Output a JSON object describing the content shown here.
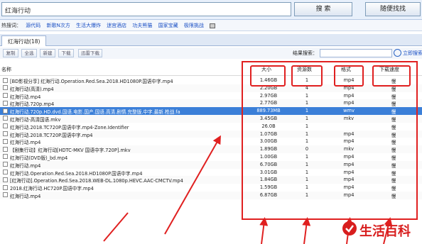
{
  "search": {
    "value": "红海行动",
    "button": "搜 索",
    "random_button": "随便找找"
  },
  "hot": {
    "label": "热搜词：",
    "links": [
      "源代码",
      "新歌N次方",
      "生活大爆炸",
      "迷宫酒店",
      "功夫熊猫",
      "国家宝藏",
      "极限挑战"
    ]
  },
  "tab": {
    "label": "红海行动(18)"
  },
  "toolbar": {
    "buttons": [
      "复制",
      "全选",
      "新建",
      "下载",
      "迅雷下载"
    ],
    "filter_label": "结果搜索：",
    "adv_label": "立即搜索"
  },
  "columns": {
    "name": "名称",
    "size": "大小",
    "sources": "资源数",
    "format": "格式",
    "speed": "下载速度"
  },
  "rows": [
    {
      "name": "[BD影视分享] 红海行动.Operation.Red.Sea.2018.HD1080P.国语中字.mp4",
      "size": "1.46GB",
      "sources": "1",
      "format": "mp4",
      "speed": "慢",
      "selected": false
    },
    {
      "name": "红海行动(高清).mp4",
      "size": "2.20GB",
      "sources": "4",
      "format": "mp4",
      "speed": "慢",
      "selected": false
    },
    {
      "name": "红海行动.mp4",
      "size": "2.97GB",
      "sources": "1",
      "format": "mp4",
      "speed": "慢",
      "selected": false
    },
    {
      "name": "红海行动.720p.mp4",
      "size": "2.77GB",
      "sources": "1",
      "format": "mp4",
      "speed": "慢",
      "selected": false
    },
    {
      "name": "红海行动.720p.HD.dvd.国语.电影.国产.国语.高清.剧情.完整版.中字.最新.枪战.fa",
      "size": "889.73MB",
      "sources": "1",
      "format": "wmv",
      "speed": "慢",
      "selected": true
    },
    {
      "name": "红海行动-高清国语.mkv",
      "size": "3.45GB",
      "sources": "1",
      "format": "mkv",
      "speed": "慢",
      "selected": false
    },
    {
      "name": "红海行动.2018.TC720P.国语中字.mp4-Zone.Identifier",
      "size": "26.0B",
      "sources": "1",
      "format": "",
      "speed": "慢",
      "selected": false
    },
    {
      "name": "红海行动.2018.TC720P.国语中字.mp4",
      "size": "1.07GB",
      "sources": "1",
      "format": "mp4",
      "speed": "慢",
      "selected": false
    },
    {
      "name": "红海行动.mp4",
      "size": "3.00GB",
      "sources": "1",
      "format": "mp4",
      "speed": "慢",
      "selected": false
    },
    {
      "name": "【剧集行动】红海行动[HDTC-MKV 国语中字.720P].mkv",
      "size": "1.89GB",
      "sources": "0",
      "format": "mkv",
      "speed": "慢",
      "selected": false
    },
    {
      "name": "红海行动(DVD版)_bd.mp4",
      "size": "1.00GB",
      "sources": "1",
      "format": "mp4",
      "speed": "慢",
      "selected": false
    },
    {
      "name": "红海行动.mp4",
      "size": "6.70GB",
      "sources": "1",
      "format": "mp4",
      "speed": "慢",
      "selected": false
    },
    {
      "name": "红海行动.Operation.Red.Sea.2018.HD1080P.国语中字.mp4",
      "size": "3.01GB",
      "sources": "1",
      "format": "mp4",
      "speed": "慢",
      "selected": false
    },
    {
      "name": "[红海行动].Operation.Red.Sea.2018.WEB-DL.1080p.HEVC.AAC-CMCTV.mp4",
      "size": "1.84GB",
      "sources": "1",
      "format": "mp4",
      "speed": "慢",
      "selected": false
    },
    {
      "name": "2018.红海行动.HC720P.国语中字.mp4",
      "size": "1.59GB",
      "sources": "1",
      "format": "mp4",
      "speed": "慢",
      "selected": false
    },
    {
      "name": "红海行动.mp4",
      "size": "6.87GB",
      "sources": "1",
      "format": "mp4",
      "speed": "慢",
      "selected": false
    }
  ],
  "watermark": "生活百科",
  "accent": "#3b7fd8",
  "annotation_color": "#e02020"
}
